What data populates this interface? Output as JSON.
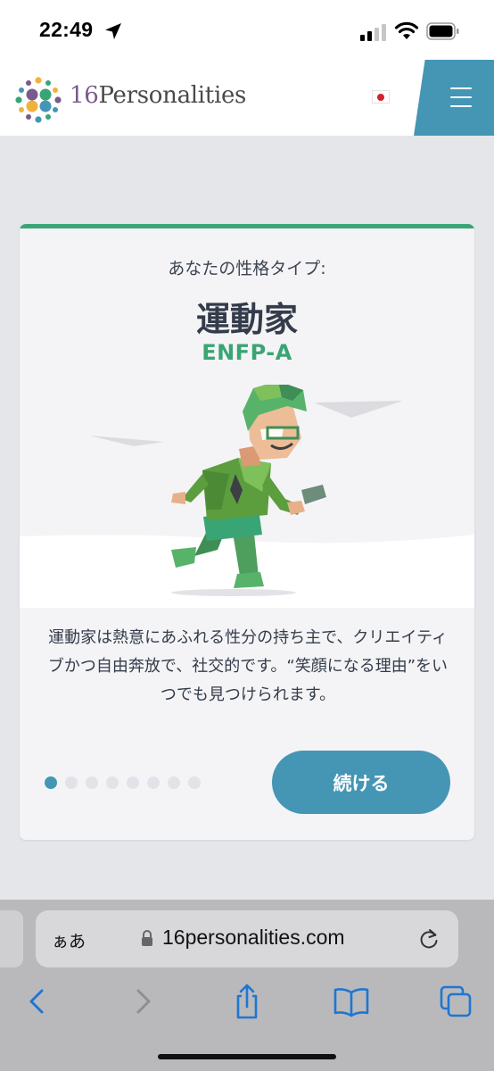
{
  "status_bar": {
    "time": "22:49"
  },
  "header": {
    "logo_number": "16",
    "logo_word": "Personalities",
    "language_flag": "Japan",
    "menu_icon": "hamburger-menu-icon"
  },
  "card": {
    "subtitle": "あなたの性格タイプ:",
    "title": "運動家",
    "code": "ENFP-A",
    "description": "運動家は熱意にあふれる性分の持ち主で、クリエイティブかつ自由奔放で、社交的です。“笑顔になる理由”をいつでも見つけられます。",
    "slides_total": 8,
    "slide_active": 1,
    "continue_label": "続ける",
    "accent_color": "#3aa574",
    "button_color": "#4496b4"
  },
  "browser": {
    "text_size_label": "ぁあ",
    "url": "16personalities.com",
    "toolbar_icons": [
      "back-icon",
      "forward-icon",
      "share-icon",
      "bookmarks-icon",
      "tabs-icon"
    ]
  }
}
